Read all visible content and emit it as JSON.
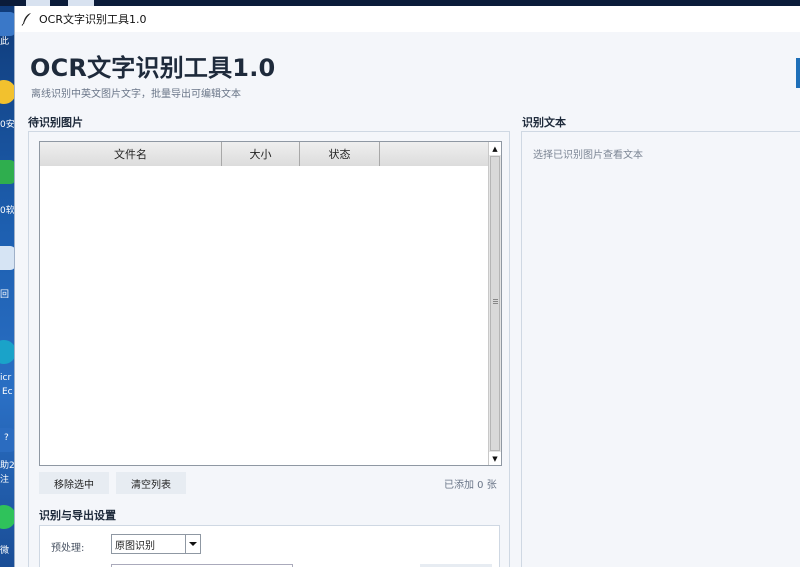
{
  "window": {
    "title": "OCR文字识别工具1.0"
  },
  "header": {
    "title": "OCR文字识别工具1.0",
    "subtitle": "离线识别中英文图片文字，批量导出可编辑文本"
  },
  "image_list": {
    "section_title": "待识别图片",
    "columns": [
      "文件名",
      "大小",
      "状态"
    ],
    "rows": [],
    "remove_button": "移除选中",
    "clear_button": "清空列表",
    "count_text": "已添加 0 张"
  },
  "settings": {
    "section_title": "识别与导出设置",
    "preprocess_label": "预处理:",
    "preprocess_value": "原图识别"
  },
  "result": {
    "section_title": "识别文本",
    "placeholder": "选择已识别图片查看文本"
  },
  "desktop": {
    "labels": [
      "此",
      "0安",
      "0软",
      "回",
      "icr",
      "Ec",
      "?",
      "助2",
      "注",
      "微"
    ]
  },
  "colors": {
    "window_bg": "#f4f6fa",
    "accent": "#1e6fb8",
    "button_bg": "#e7ecf2"
  }
}
